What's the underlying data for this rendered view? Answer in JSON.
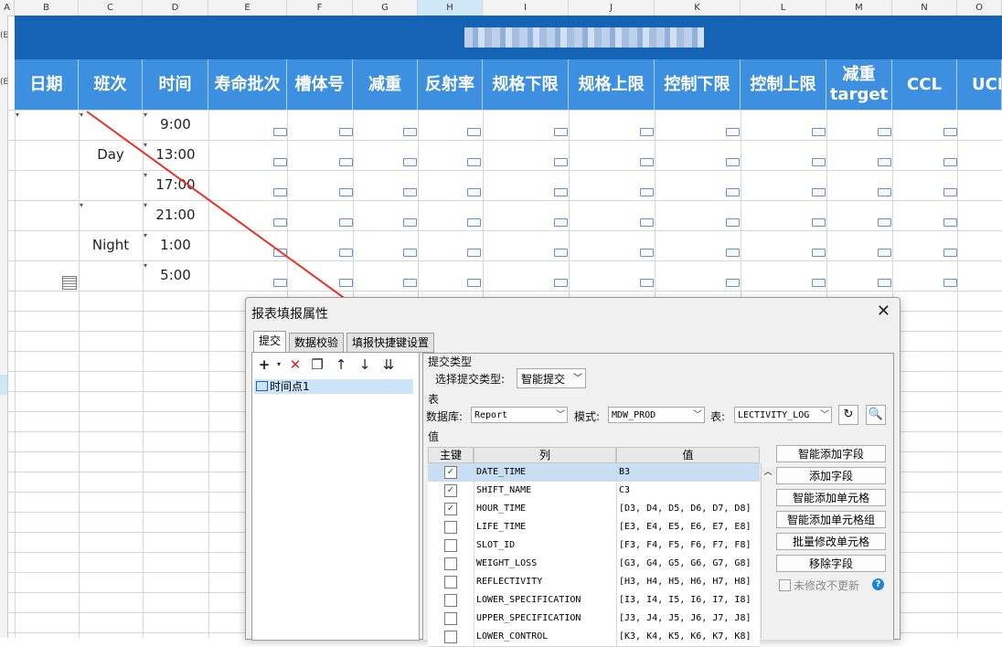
{
  "sheet": {
    "columns": [
      "A",
      "B",
      "C",
      "D",
      "E",
      "F",
      "G",
      "H",
      "I",
      "J",
      "K",
      "L",
      "M",
      "N",
      "O"
    ],
    "row_markers": [
      "(E",
      "(E"
    ],
    "headers": [
      "日期",
      "班次",
      "时间",
      "寿命批次",
      "槽体号",
      "减重",
      "反射率",
      "规格下限",
      "规格上限",
      "控制下限",
      "控制上限",
      "减重\ntarget",
      "CCL",
      "UCL"
    ],
    "shifts": [
      "Day",
      "Night"
    ],
    "times": [
      "9:00",
      "13:00",
      "17:00",
      "21:00",
      "1:00",
      "5:00"
    ]
  },
  "dialog": {
    "title": "报表填报属性",
    "close": "✕",
    "tabs": [
      "提交",
      "数据校验",
      "填报快捷键设置"
    ],
    "toolbar_icons": [
      "add-icon",
      "delete-icon",
      "copy-icon",
      "move-up-icon",
      "move-down-icon",
      "sort-icon"
    ],
    "tree_item": "时间点1",
    "submit_type_group": "提交类型",
    "submit_type_label": "选择提交类型:",
    "submit_type_value": "智能提交",
    "table_group": "表",
    "db_label": "数据库:",
    "db_value": "Report",
    "mode_label": "模式:",
    "mode_value": "MDW_PROD",
    "table_label": "表:",
    "table_value": "LECTIVITY_LOG",
    "values_group": "值",
    "col_key": "主键",
    "col_column": "列",
    "col_value": "值",
    "rows": [
      {
        "checked": true,
        "column": "DATE_TIME",
        "value": "B3"
      },
      {
        "checked": true,
        "column": "SHIFT_NAME",
        "value": "C3"
      },
      {
        "checked": true,
        "column": "HOUR_TIME",
        "value": "[D3, D4, D5, D6, D7, D8]"
      },
      {
        "checked": false,
        "column": "LIFE_TIME",
        "value": "[E3, E4, E5, E6, E7, E8]"
      },
      {
        "checked": false,
        "column": "SLOT_ID",
        "value": "[F3, F4, F5, F6, F7, F8]"
      },
      {
        "checked": false,
        "column": "WEIGHT_LOSS",
        "value": "[G3, G4, G5, G6, G7, G8]"
      },
      {
        "checked": false,
        "column": "REFLECTIVITY",
        "value": "[H3, H4, H5, H6, H7, H8]"
      },
      {
        "checked": false,
        "column": "LOWER_SPECIFICATION",
        "value": "[I3, I4, I5, I6, I7, I8]"
      },
      {
        "checked": false,
        "column": "UPPER_SPECIFICATION",
        "value": "[J3, J4, J5, J6, J7, J8]"
      },
      {
        "checked": false,
        "column": "LOWER_CONTROL",
        "value": "[K3, K4, K5, K6, K7, K8]"
      }
    ],
    "side_buttons": [
      "智能添加字段",
      "添加字段",
      "智能添加单元格",
      "智能添加单元格组",
      "批量修改单元格",
      "移除字段"
    ],
    "no_update_label": "未修改不更新",
    "help_icon": "?",
    "check_mark": "✓"
  },
  "annotation_color": "#e8332a"
}
